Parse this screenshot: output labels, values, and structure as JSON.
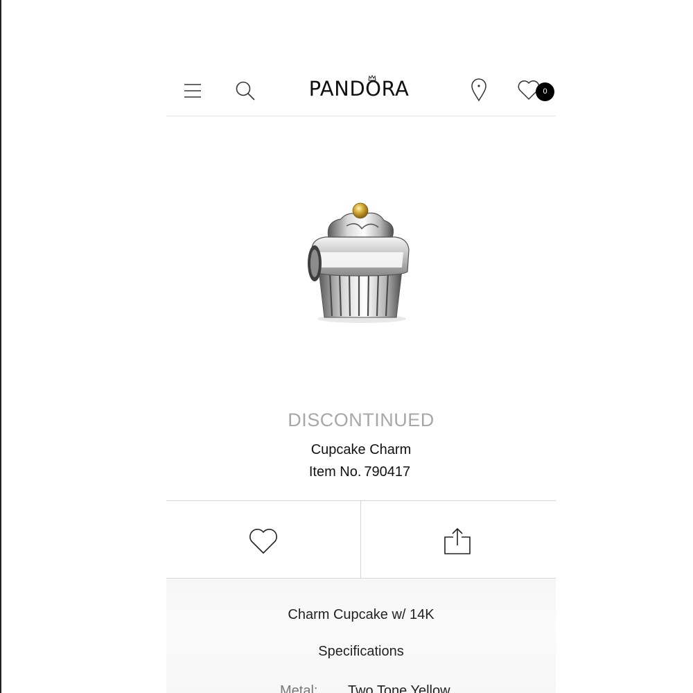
{
  "header": {
    "brand": "PANDORA",
    "wishlist_count": "0"
  },
  "icons": {
    "menu": "hamburger-menu-icon",
    "search": "search-icon",
    "store_locator": "map-pin-icon",
    "wishlist": "heart-icon",
    "share": "share-icon"
  },
  "product": {
    "status": "DISCONTINUED",
    "name": "Cupcake Charm",
    "item_label": "Item No.",
    "item_number": "790417",
    "image_alt": "Cupcake charm, sterling silver with 14K gold accent"
  },
  "description": {
    "title": "Charm Cupcake w/ 14K",
    "specifications_heading": "Specifications",
    "specs": [
      {
        "label": "Metal:",
        "value": "Two Tone Yellow"
      }
    ]
  },
  "colors": {
    "status_gray": "#a8a8a8",
    "badge_black": "#000000",
    "divider": "#d6d6d6",
    "gold_accent": "#c9a227"
  }
}
